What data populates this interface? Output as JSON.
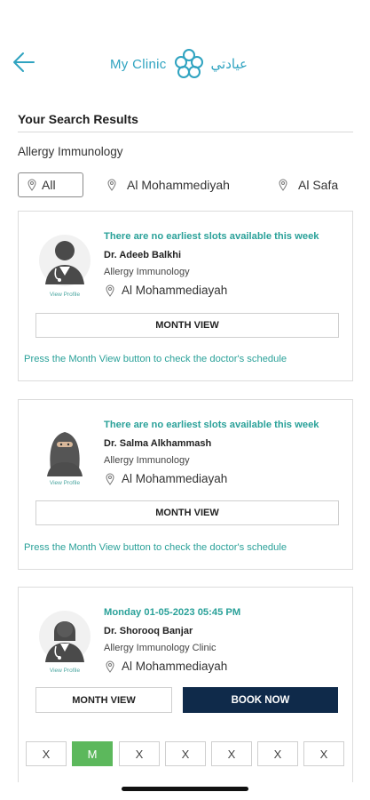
{
  "header": {
    "logo_en": "My Clinic",
    "logo_ar": "عيادتي",
    "accent_color": "#2fa3c0"
  },
  "results": {
    "title": "Your Search Results",
    "specialty": "Allergy Immunology"
  },
  "filters": [
    {
      "label": "All",
      "active": true
    },
    {
      "label": "Al Mohammediyah",
      "active": false
    },
    {
      "label": "Al Safa",
      "active": false
    }
  ],
  "cards": [
    {
      "slot_message": "There are no earliest slots available this week",
      "name": "Dr. Adeeb Balkhi",
      "specialty": "Allergy Immunology",
      "location": "Al Mohammediayah",
      "view_profile": "View Profile",
      "month_view": "MONTH VIEW",
      "hint": "Press the Month View button to check the doctor's schedule",
      "avatar": "male-doctor-icon"
    },
    {
      "slot_message": "There are no earliest slots available this week",
      "name": "Dr. Salma Alkhammash",
      "specialty": "Allergy Immunology",
      "location": "Al Mohammediayah",
      "view_profile": "View Profile",
      "month_view": "MONTH VIEW",
      "hint": "Press the Month View button to check the doctor's schedule",
      "avatar": "female-niqab-doctor-icon"
    },
    {
      "slot_message": "Monday 01-05-2023 05:45 PM",
      "name": "Dr. Shorooq Banjar",
      "specialty": "Allergy Immunology Clinic",
      "location": "Al Mohammediayah",
      "view_profile": "View Profile",
      "month_view": "MONTH VIEW",
      "book_now": "BOOK NOW",
      "avatar": "female-doctor-icon"
    }
  ],
  "week_days": [
    "X",
    "M",
    "X",
    "X",
    "X",
    "X",
    "X"
  ],
  "colors": {
    "teal_text": "#2aa199",
    "book_button": "#0f2a4a",
    "available_day": "#5cb85c"
  }
}
